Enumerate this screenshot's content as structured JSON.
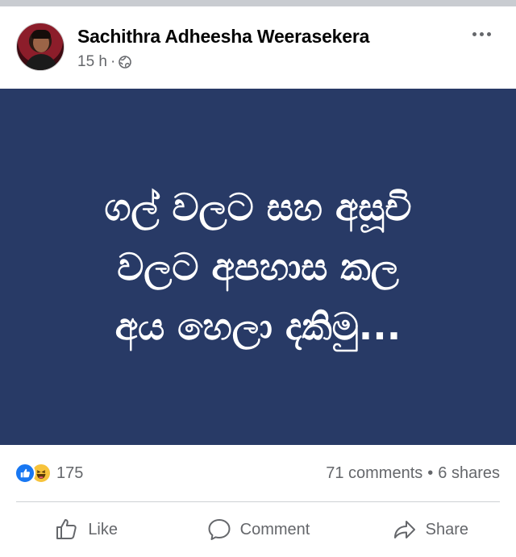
{
  "post": {
    "author": "Sachithra Adheesha Weerasekera",
    "time": "15 h",
    "separator": "·",
    "image_lines": [
      "ගල් වලට සහ අසූචි",
      "වලට අපහාස කල",
      "අය හෙලා දකිමු..."
    ],
    "image_background": "#283a66"
  },
  "stats": {
    "reaction_count": "175",
    "comments": "71 comments",
    "dot": "•",
    "shares": "6 shares"
  },
  "actions": {
    "like": "Like",
    "comment": "Comment",
    "share": "Share"
  },
  "icons": [
    "avatar",
    "globe-icon",
    "more-icon",
    "like-reaction-icon",
    "haha-reaction-icon",
    "like-icon",
    "comment-icon",
    "share-icon"
  ]
}
